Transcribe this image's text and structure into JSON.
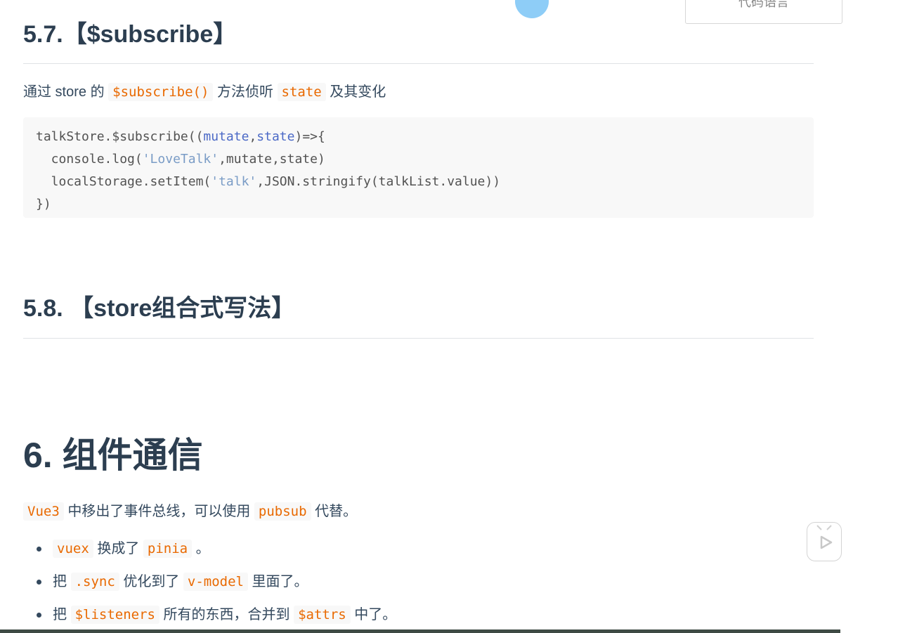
{
  "section_57": {
    "title": "5.7.【$subscribe】",
    "desc_pre": "通过 store 的 ",
    "desc_code1": "$subscribe()",
    "desc_mid": " 方法侦听 ",
    "desc_code2": "state",
    "desc_post": " 及其变化",
    "code": {
      "l1_a": "talkStore.$subscribe((",
      "l1_kw1": "mutate",
      "l1_b": ",",
      "l1_kw2": "state",
      "l1_c": ")=>{",
      "l2_a": "  console.log(",
      "l2_str": "'LoveTalk'",
      "l2_b": ",mutate,state)",
      "l3_a": "  localStorage.setItem(",
      "l3_str": "'talk'",
      "l3_b": ",JSON.stringify(talkList.value))",
      "l4": "})"
    }
  },
  "section_58": {
    "title": "5.8. 【store组合式写法】"
  },
  "section_6": {
    "title": "6. 组件通信",
    "intro_code1": "Vue3",
    "intro_mid": " 中移出了事件总线，可以使用 ",
    "intro_code2": "pubsub",
    "intro_post": " 代替。",
    "bullets": [
      {
        "code1": "vuex",
        "mid": " 换成了 ",
        "code2": "pinia",
        "post": " 。",
        "pre": ""
      },
      {
        "pre": "把 ",
        "code1": ".sync",
        "mid": " 优化到了 ",
        "code2": "v-model",
        "post": " 里面了。"
      },
      {
        "pre": "把 ",
        "code1": "$listeners",
        "mid": " 所有的东西，合并到 ",
        "code2": "$attrs",
        "post": " 中了。"
      }
    ]
  },
  "overlay": {
    "top_button_label": "代码语言"
  },
  "colors": {
    "inline_code": "#e96900",
    "heading": "#2c3e50",
    "text": "#34495e",
    "code_keyword": "#4b69c6",
    "code_string": "#7a9cc6"
  }
}
